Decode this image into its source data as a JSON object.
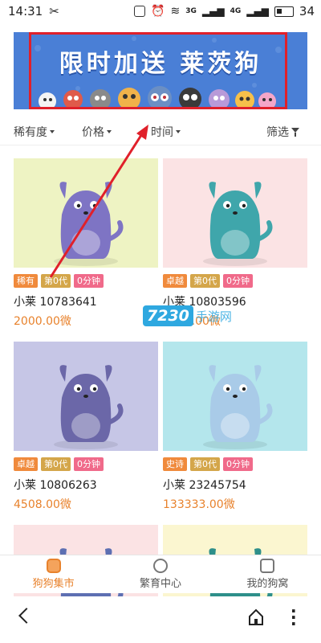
{
  "status_bar": {
    "time": "14:31",
    "signal_1": "3G",
    "signal_2": "4G",
    "battery": "34"
  },
  "banner": {
    "title": "限时加送 莱茨狗"
  },
  "filters": [
    {
      "label": "稀有度"
    },
    {
      "label": "价格"
    },
    {
      "label": "时间"
    },
    {
      "label": "筛选"
    }
  ],
  "cards": [
    {
      "name": "小莱 10783641",
      "price": "2000.00微",
      "bg": "#eef3c3",
      "body": "#7e74c4",
      "tags": [
        {
          "text": "稀有",
          "color": "#f08a3c"
        },
        {
          "text": "第0代",
          "color": "#d4a64a"
        },
        {
          "text": "0分钟",
          "color": "#f06a8a"
        }
      ]
    },
    {
      "name": "小莱 10803596",
      "price": "4508.00微",
      "bg": "#fbe3e4",
      "body": "#3fa6ab",
      "tags": [
        {
          "text": "卓越",
          "color": "#f08a3c"
        },
        {
          "text": "第0代",
          "color": "#d4a64a"
        },
        {
          "text": "0分钟",
          "color": "#f06a8a"
        }
      ]
    },
    {
      "name": "小莱 10806263",
      "price": "4508.00微",
      "bg": "#c6c6e6",
      "body": "#6b67a8",
      "tags": [
        {
          "text": "卓越",
          "color": "#f08a3c"
        },
        {
          "text": "第0代",
          "color": "#d4a64a"
        },
        {
          "text": "0分钟",
          "color": "#f06a8a"
        }
      ]
    },
    {
      "name": "小莱 23245754",
      "price": "133333.00微",
      "bg": "#b4e6ec",
      "body": "#a9cbe8",
      "tags": [
        {
          "text": "史诗",
          "color": "#f08a3c"
        },
        {
          "text": "第0代",
          "color": "#d4a64a"
        },
        {
          "text": "0分钟",
          "color": "#f06a8a"
        }
      ]
    },
    {
      "bg": "#fbe3e4",
      "body": "#5d6fb2"
    },
    {
      "bg": "#fbf6d0",
      "body": "#2e8f8a"
    }
  ],
  "watermark": {
    "number": "7230",
    "text": "手游网"
  },
  "tabs": [
    {
      "label": "狗狗集市",
      "icon": "dog-market-icon",
      "active": true
    },
    {
      "label": "繁育中心",
      "icon": "breeding-icon",
      "active": false
    },
    {
      "label": "我的狗窝",
      "icon": "profile-icon",
      "active": false
    }
  ],
  "colors": {
    "accent": "#e8822c",
    "annotation_red": "#e0202a",
    "banner_blue": "#4a7fd6"
  }
}
